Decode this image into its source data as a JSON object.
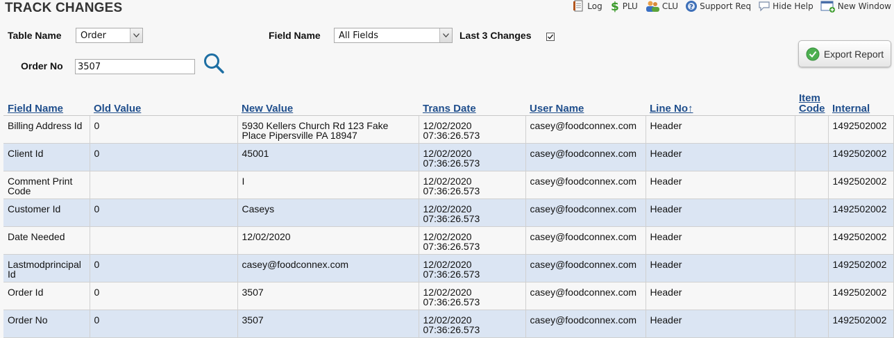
{
  "page": {
    "title": "TRACK CHANGES"
  },
  "toolbar": [
    {
      "name": "log",
      "label": "Log",
      "icon": "log-icon"
    },
    {
      "name": "plu",
      "label": "PLU",
      "icon": "dollar-icon"
    },
    {
      "name": "clu",
      "label": "CLU",
      "icon": "users-icon"
    },
    {
      "name": "support",
      "label": "Support Req",
      "icon": "support-icon"
    },
    {
      "name": "help",
      "label": "Hide Help",
      "icon": "speech-bubble-icon"
    },
    {
      "name": "window",
      "label": "New Window",
      "icon": "new-window-icon"
    }
  ],
  "filters": {
    "table_name_label": "Table Name",
    "table_name_value": "Order",
    "field_name_label": "Field Name",
    "field_name_value": "All Fields",
    "last3_label": "Last 3 Changes",
    "last3_checked": true,
    "order_no_label": "Order No",
    "order_no_value": "3507"
  },
  "export_button": {
    "label": "Export Report"
  },
  "table": {
    "columns": [
      "Field Name",
      "Old Value",
      "New Value",
      "Trans Date",
      "User Name",
      "Line No↑",
      "Item Code",
      "Internal"
    ],
    "rows": [
      [
        "Billing Address Id",
        "0",
        "5930 Kellers Church Rd 123 Fake Place Pipersville PA 18947",
        "12/02/2020 07:36:26.573",
        "casey@foodconnex.com",
        "Header",
        "",
        "1492502002"
      ],
      [
        "Client Id",
        "0",
        "45001",
        "12/02/2020 07:36:26.573",
        "casey@foodconnex.com",
        "Header",
        "",
        "1492502002"
      ],
      [
        "Comment Print Code",
        "",
        "I",
        "12/02/2020 07:36:26.573",
        "casey@foodconnex.com",
        "Header",
        "",
        "1492502002"
      ],
      [
        "Customer Id",
        "0",
        "Caseys",
        "12/02/2020 07:36:26.573",
        "casey@foodconnex.com",
        "Header",
        "",
        "1492502002"
      ],
      [
        "Date Needed",
        "",
        "12/02/2020",
        "12/02/2020 07:36:26.573",
        "casey@foodconnex.com",
        "Header",
        "",
        "1492502002"
      ],
      [
        "Lastmodprincipal Id",
        "0",
        "casey@foodconnex.com",
        "12/02/2020 07:36:26.573",
        "casey@foodconnex.com",
        "Header",
        "",
        "1492502002"
      ],
      [
        "Order Id",
        "0",
        "3507",
        "12/02/2020 07:36:26.573",
        "casey@foodconnex.com",
        "Header",
        "",
        "1492502002"
      ],
      [
        "Order No",
        "0",
        "3507",
        "12/02/2020 07:36:26.573",
        "casey@foodconnex.com",
        "Header",
        "",
        "1492502002"
      ]
    ]
  }
}
